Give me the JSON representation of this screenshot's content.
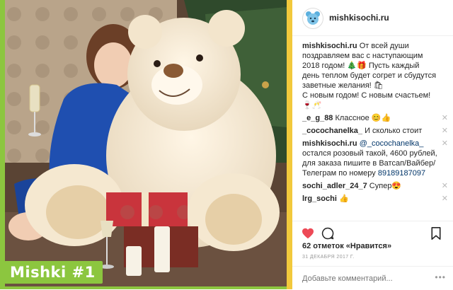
{
  "post": {
    "username": "mishkisochi.ru",
    "watermark": "Mishki #1",
    "caption_user": "mishkisochi.ru",
    "caption_text": "От всей души поздравляем вас с наступающим 2018 годом! 🎄🎁 Пусть каждый день теплом будет согрет и сбудутся заветные желания! 🛍",
    "caption_text2": "С новым годом! С новым счастьем! 🍷🥂",
    "comments": [
      {
        "user": "_e_g_88",
        "text": "Классное 😊👍"
      },
      {
        "user": "_cocochanelka_",
        "text": "И сколько стоит"
      },
      {
        "user": "mishkisochi.ru",
        "mention": "@_cocochanelka_",
        "text": "остался розовый такой, 4600 рублей, для заказа пишите в Ватсап/Вайбер/Телеграм по номеру",
        "phone": "89189187097"
      },
      {
        "user": "sochi_adler_24_7",
        "text": "Супер😍"
      },
      {
        "user": "lrg_sochi",
        "text": "👍"
      }
    ],
    "likes": "62 отметок «Нравится»",
    "date": "31 ДЕКАБРЯ 2017 Г.",
    "add_comment_placeholder": "Добавьте комментарий...",
    "more": "•••",
    "close_glyph": "✕"
  },
  "colors": {
    "accent_green": "#8cc63f",
    "accent_yellow": "#f2c93c",
    "heart_red": "#ed4956",
    "link_blue": "#003569"
  }
}
